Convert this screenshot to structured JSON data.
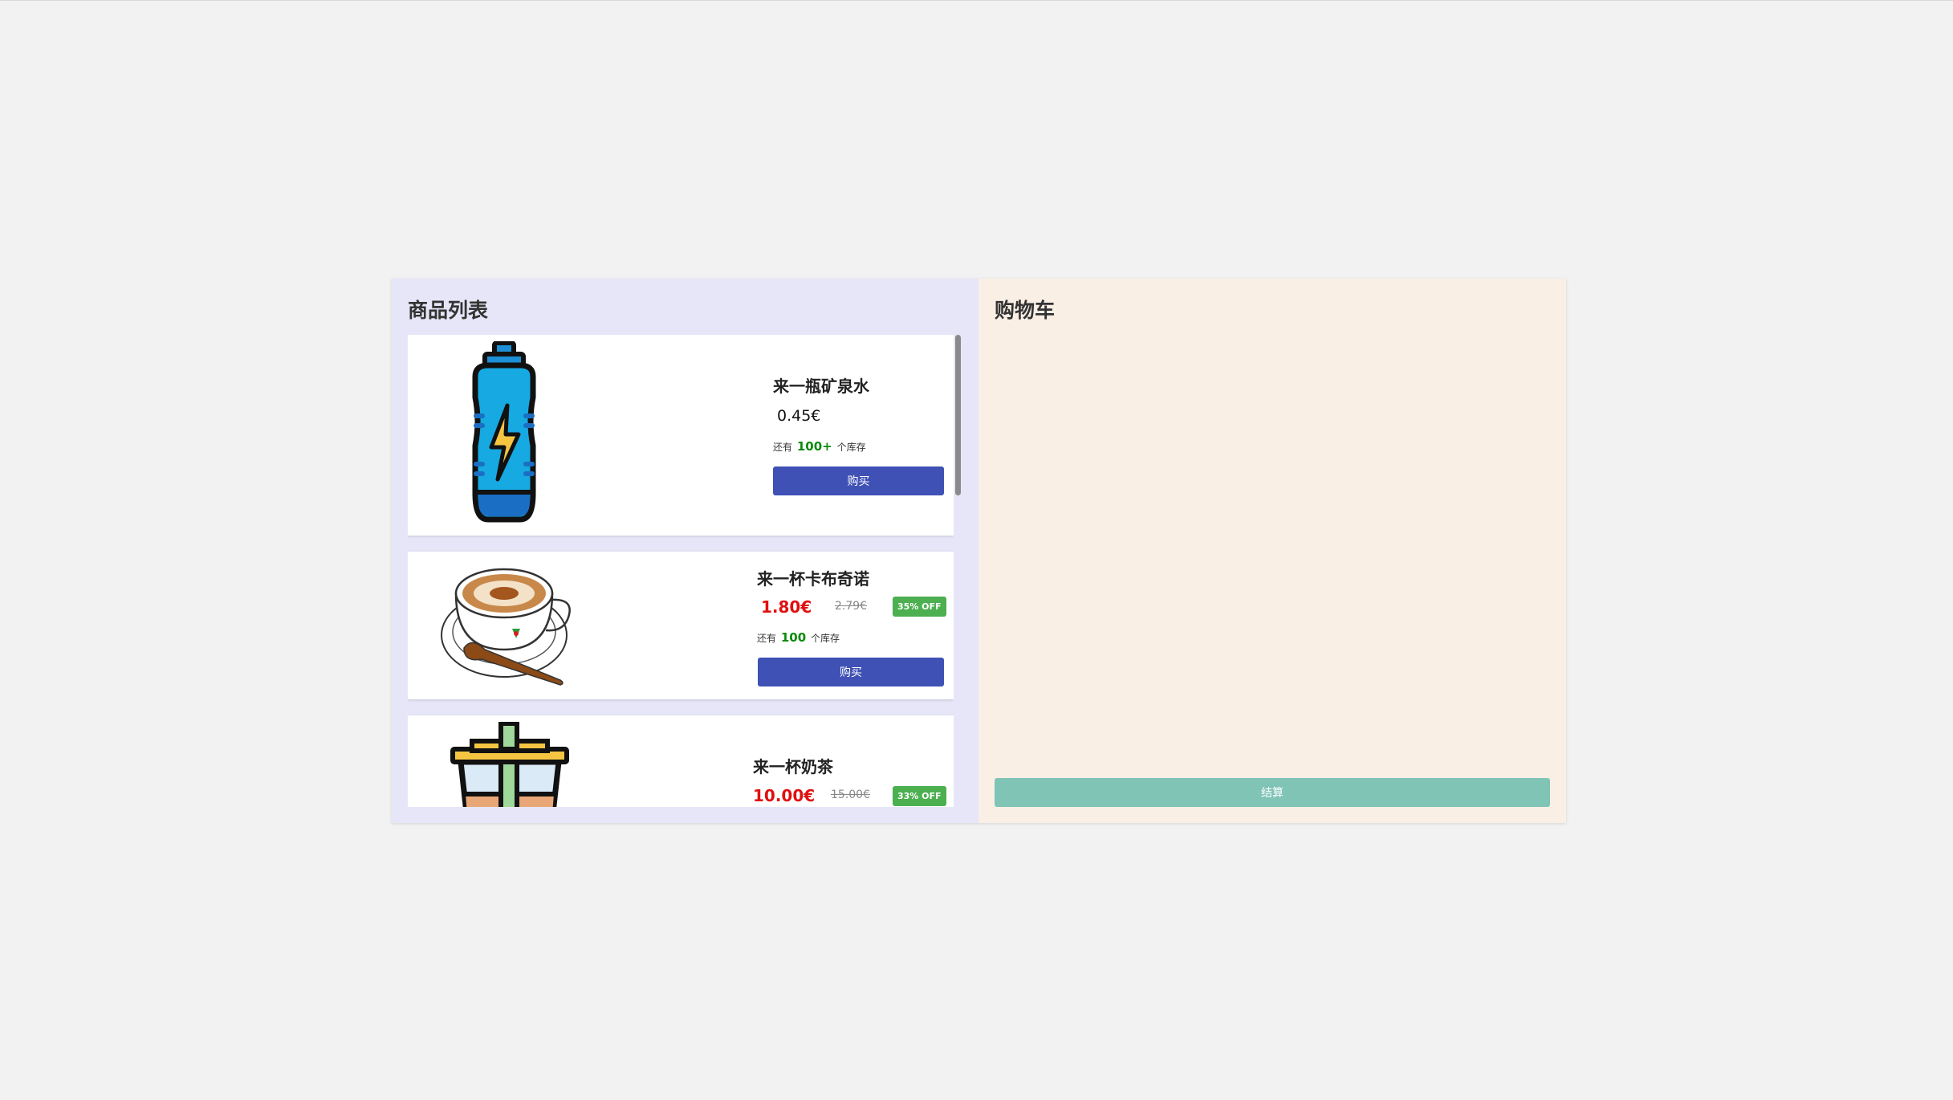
{
  "products_panel": {
    "title": "商品列表",
    "buy_label": "购买",
    "stock_prefix": "还有",
    "stock_suffix": "个库存"
  },
  "products": [
    {
      "name": "来一瓶矿泉水",
      "price": "0.45€",
      "stock": "100+",
      "image_icon": "water-bottle-icon",
      "on_sale": false
    },
    {
      "name": "来一杯卡布奇诺",
      "price": "1.80€",
      "old_price": "2.79€",
      "discount": "35% OFF",
      "stock": "100",
      "image_icon": "cappuccino-cup-icon",
      "on_sale": true
    },
    {
      "name": "来一杯奶茶",
      "price": "10.00€",
      "old_price": "15.00€",
      "discount": "33% OFF",
      "image_icon": "milk-tea-cup-icon",
      "on_sale": true
    }
  ],
  "cart_panel": {
    "title": "购物车",
    "checkout_label": "结算"
  },
  "colors": {
    "products_bg": "#e6e6f8",
    "cart_bg": "#f9efe5",
    "buy_button": "#3f51b5",
    "checkout_button": "#80c4b6",
    "sale_price": "#e01010",
    "discount_badge": "#4caf50",
    "stock_number": "#0a8a0a"
  }
}
